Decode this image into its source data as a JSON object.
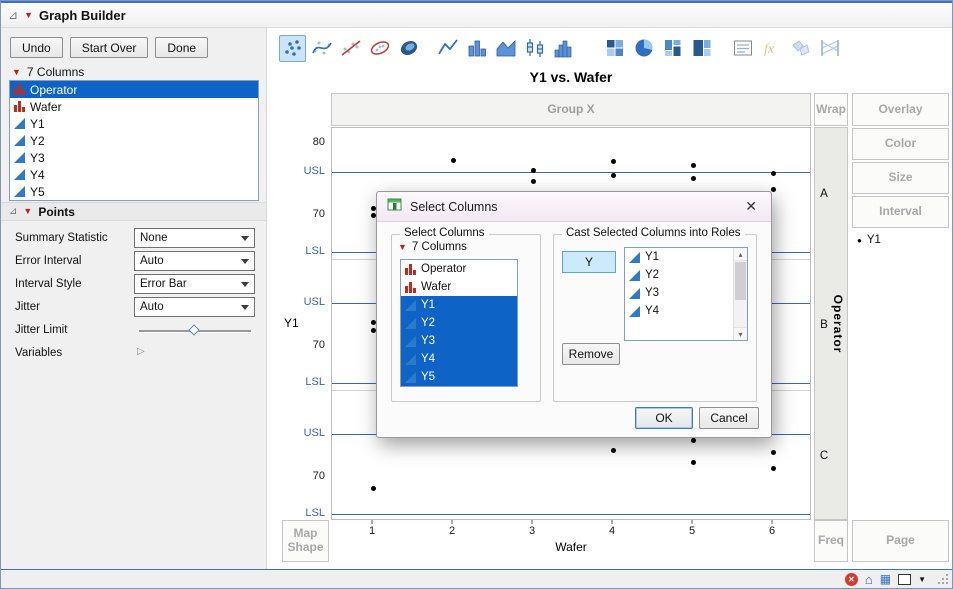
{
  "window": {
    "title": "Graph Builder",
    "action_buttons": [
      {
        "label": "Undo"
      },
      {
        "label": "Start Over"
      },
      {
        "label": "Done"
      }
    ]
  },
  "columns_panel": {
    "header": "7 Columns",
    "items": [
      {
        "label": "Operator",
        "icon": "nominal-column-icon",
        "selected": true
      },
      {
        "label": "Wafer",
        "icon": "nominal-column-icon",
        "selected": false
      },
      {
        "label": "Y1",
        "icon": "continuous-column-icon",
        "selected": false
      },
      {
        "label": "Y2",
        "icon": "continuous-column-icon",
        "selected": false
      },
      {
        "label": "Y3",
        "icon": "continuous-column-icon",
        "selected": false
      },
      {
        "label": "Y4",
        "icon": "continuous-column-icon",
        "selected": false
      },
      {
        "label": "Y5",
        "icon": "continuous-column-icon",
        "selected": false
      }
    ]
  },
  "points_panel": {
    "title": "Points",
    "controls": [
      {
        "label": "Summary Statistic",
        "value": "None",
        "type": "dropdown"
      },
      {
        "label": "Error Interval",
        "value": "Auto",
        "type": "dropdown"
      },
      {
        "label": "Interval Style",
        "value": "Error Bar",
        "type": "dropdown"
      },
      {
        "label": "Jitter",
        "value": "Auto",
        "type": "dropdown"
      },
      {
        "label": "Jitter Limit",
        "value": 0.5,
        "type": "slider"
      },
      {
        "label": "Variables",
        "type": "disclosure"
      }
    ]
  },
  "element_toolbar": {
    "icons": [
      {
        "name": "points-icon",
        "group": 1,
        "selected": true
      },
      {
        "name": "smoother-icon",
        "group": 1
      },
      {
        "name": "line-of-fit-icon",
        "group": 1
      },
      {
        "name": "ellipse-icon",
        "group": 1
      },
      {
        "name": "contour-icon",
        "group": 1
      },
      {
        "name": "line-icon",
        "group": 2
      },
      {
        "name": "bar-icon",
        "group": 2
      },
      {
        "name": "area-icon",
        "group": 2
      },
      {
        "name": "box-plot-icon",
        "group": 2
      },
      {
        "name": "histogram-icon",
        "group": 2
      },
      {
        "name": "heatmap-icon",
        "group": 3
      },
      {
        "name": "pie-icon",
        "group": 3
      },
      {
        "name": "mosaic-icon",
        "group": 3
      },
      {
        "name": "treemap-icon",
        "group": 3
      },
      {
        "name": "caption-box-icon",
        "group": 4
      },
      {
        "name": "formula-icon",
        "group": 4,
        "disabled": true
      },
      {
        "name": "map-shapes-icon",
        "group": 4,
        "disabled": true
      },
      {
        "name": "parallel-icon",
        "group": 4,
        "disabled": true
      }
    ]
  },
  "chart": {
    "title": "Y1 vs. Wafer",
    "zones": {
      "group_x": "Group X",
      "wrap": "Wrap",
      "overlay": "Overlay",
      "color": "Color",
      "size": "Size",
      "interval": "Interval",
      "map_shape": "Map Shape",
      "freq": "Freq",
      "page": "Page"
    },
    "legend": {
      "marker": "●",
      "series": "Y1"
    }
  },
  "chart_data": {
    "type": "scatter",
    "title": "Y1 vs. Wafer",
    "xlabel": "Wafer",
    "ylabel": "Y1",
    "group_var": "Operator",
    "groups": [
      "A",
      "B",
      "C"
    ],
    "x_ticks": [
      1,
      2,
      3,
      4,
      5,
      6
    ],
    "y_axis": {
      "min": 64,
      "max": 82
    },
    "spec_limits": {
      "usl": 76,
      "lsl": 65,
      "usl_label": "USL",
      "lsl_label": "LSL"
    },
    "y_ticks": [
      {
        "label": "80",
        "value": 80,
        "panels": [
          0
        ],
        "spec": false
      },
      {
        "label": "USL",
        "value": 76,
        "panels": [
          0,
          1,
          2
        ],
        "spec": true
      },
      {
        "label": "70",
        "value": 70,
        "panels": [
          0,
          1,
          2
        ],
        "spec": false
      },
      {
        "label": "LSL",
        "value": 65,
        "panels": [
          0,
          1,
          2
        ],
        "spec": true
      }
    ],
    "series": [
      {
        "name": "Y1",
        "color": "#000000"
      }
    ],
    "points": [
      {
        "group": "A",
        "x": 1,
        "y": 71.0
      },
      {
        "group": "A",
        "x": 1,
        "y": 70.0
      },
      {
        "group": "A",
        "x": 2,
        "y": 77.6
      },
      {
        "group": "A",
        "x": 3,
        "y": 76.2
      },
      {
        "group": "A",
        "x": 3,
        "y": 74.6
      },
      {
        "group": "A",
        "x": 4,
        "y": 77.4
      },
      {
        "group": "A",
        "x": 4,
        "y": 75.5
      },
      {
        "group": "A",
        "x": 5,
        "y": 76.9
      },
      {
        "group": "A",
        "x": 5,
        "y": 75.1
      },
      {
        "group": "A",
        "x": 6,
        "y": 75.7
      },
      {
        "group": "A",
        "x": 6,
        "y": 73.5
      },
      {
        "group": "B",
        "x": 1,
        "y": 73.3
      },
      {
        "group": "B",
        "x": 1,
        "y": 72.2
      },
      {
        "group": "C",
        "x": 1,
        "y": 68.5
      },
      {
        "group": "C",
        "x": 4,
        "y": 73.7
      },
      {
        "group": "C",
        "x": 5,
        "y": 75.0
      },
      {
        "group": "C",
        "x": 5,
        "y": 72.0
      },
      {
        "group": "C",
        "x": 6,
        "y": 73.4
      },
      {
        "group": "C",
        "x": 6,
        "y": 71.2
      }
    ]
  },
  "dialog": {
    "title": "Select Columns",
    "close": "✕",
    "select_columns": {
      "legend": "Select Columns",
      "header": "7 Columns",
      "items": [
        {
          "label": "Operator",
          "icon": "nominal-column-icon",
          "selected": false
        },
        {
          "label": "Wafer",
          "icon": "nominal-column-icon",
          "selected": false
        },
        {
          "label": "Y1",
          "icon": "continuous-column-icon",
          "selected": true
        },
        {
          "label": "Y2",
          "icon": "continuous-column-icon",
          "selected": true
        },
        {
          "label": "Y3",
          "icon": "continuous-column-icon",
          "selected": true
        },
        {
          "label": "Y4",
          "icon": "continuous-column-icon",
          "selected": true
        },
        {
          "label": "Y5",
          "icon": "continuous-column-icon",
          "selected": true
        }
      ]
    },
    "cast_roles": {
      "legend": "Cast Selected Columns into Roles",
      "role_button": "Y",
      "items": [
        {
          "label": "Y1",
          "icon": "continuous-column-icon"
        },
        {
          "label": "Y2",
          "icon": "continuous-column-icon"
        },
        {
          "label": "Y3",
          "icon": "continuous-column-icon"
        },
        {
          "label": "Y4",
          "icon": "continuous-column-icon"
        }
      ],
      "remove_button": "Remove"
    },
    "ok_button": "OK",
    "cancel_button": "Cancel"
  },
  "status_bar": {
    "icons": [
      "error-status-icon",
      "home-icon",
      "data-table-icon",
      "window-icon",
      "dropdown-arrow-icon",
      "resize-grip"
    ]
  },
  "colors": {
    "selection_blue": "#0e63c6",
    "spec_line_blue": "#3a64c8",
    "accent_blue": "#3f6fc4",
    "nominal_icon_red": "#c02b1b",
    "continuous_icon_blue": "#2e79c8",
    "role_button_blue": "#cdeafc",
    "dialog_titlebar_tint": "#f2e8f2"
  }
}
